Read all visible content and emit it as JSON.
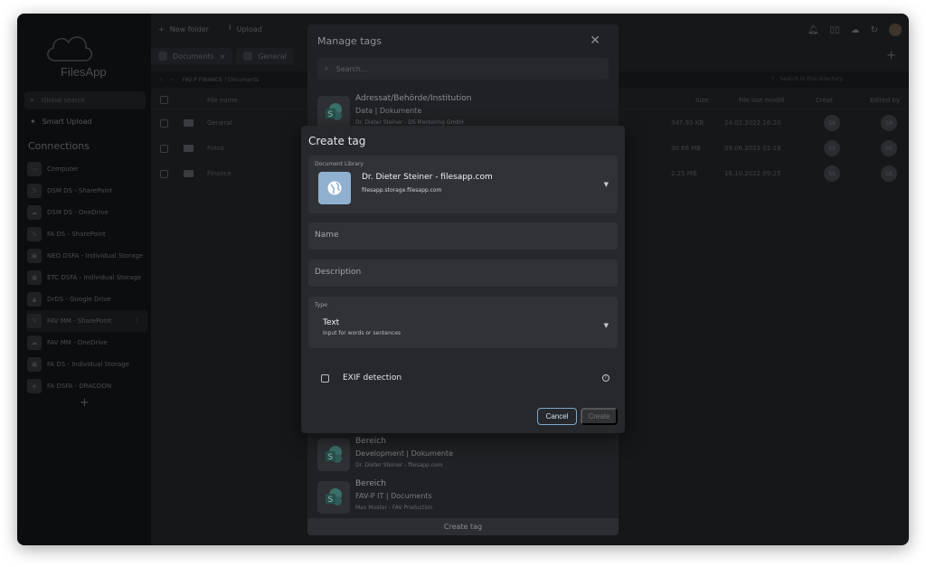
{
  "app": {
    "name": "FilesApp"
  },
  "sidebar": {
    "search_placeholder": "Global search",
    "smart_upload": "Smart Upload",
    "connections_title": "Connections",
    "connections": [
      {
        "label": "Computer",
        "icon": "computer-icon"
      },
      {
        "label": "DSM DS - SharePoint",
        "icon": "sharepoint-icon"
      },
      {
        "label": "DSM DS - OneDrive",
        "icon": "onedrive-icon"
      },
      {
        "label": "FA DS - SharePoint",
        "icon": "sharepoint-icon"
      },
      {
        "label": "NEO DSFA - Individual Storage",
        "icon": "storage-icon"
      },
      {
        "label": "ETC DSFA - Individual Storage",
        "icon": "storage-icon"
      },
      {
        "label": "DrDS - Google Drive",
        "icon": "google-drive-icon"
      },
      {
        "label": "FAV MM - SharePoint",
        "icon": "sharepoint-icon"
      },
      {
        "label": "FAV MM - OneDrive",
        "icon": "onedrive-icon"
      },
      {
        "label": "FA DS - Individual Storage",
        "icon": "storage-icon"
      },
      {
        "label": "FA DSFA - DRACOON",
        "icon": "dracoon-icon"
      }
    ]
  },
  "toolbar": {
    "new_folder": "New folder",
    "upload": "Upload"
  },
  "tabs": [
    {
      "label": "Documents"
    },
    {
      "label": "General"
    }
  ],
  "path": {
    "breadcrumb": "FAV-P FINANCE | Documents",
    "dir_search_placeholder": "Search in this directory..."
  },
  "table": {
    "headers": {
      "name": "File name",
      "size": "Size",
      "modified": "File last modifi",
      "created": "Creat",
      "edited": "Edited by"
    },
    "rows": [
      {
        "name": "General",
        "size": "347.93 KB",
        "modified": "24.02.2022 16:20",
        "creator": "SA",
        "editor": "SA"
      },
      {
        "name": "Fotos",
        "size": "30.66 MB",
        "modified": "09.06.2023 01:18",
        "creator": "SS",
        "editor": "SS"
      },
      {
        "name": "Finance",
        "size": "2.25 MB",
        "modified": "16.10.2022 09:25",
        "creator": "SS",
        "editor": "SS"
      }
    ]
  },
  "manage_tags": {
    "title": "Manage tags",
    "search_placeholder": "Search...",
    "items": [
      {
        "title": "Adressat/Behörde/Institution",
        "sub": "Data | Dokumente",
        "owner": "Dr. Dieter Steiner - DS Mentoring GmbH"
      },
      {
        "title": "Bereich",
        "sub": "Development | Dokumente",
        "owner": "Dr. Dieter Steiner - filesapp.com"
      },
      {
        "title": "Bereich",
        "sub": "FAV-P IT | Documents",
        "owner": "Max Muster - FAV Production"
      }
    ],
    "create_button": "Create tag"
  },
  "create_tag": {
    "title": "Create tag",
    "library_label": "Document Library",
    "library_name": "Dr. Dieter Steiner - filesapp.com",
    "library_host": "filesapp.storage.filesapp.com",
    "name_placeholder": "Name",
    "description_placeholder": "Description",
    "type_label": "Type",
    "type_value": "Text",
    "type_hint": "Input for words or sentences",
    "exif_label": "EXIF detection",
    "cancel": "Cancel",
    "create": "Create"
  }
}
